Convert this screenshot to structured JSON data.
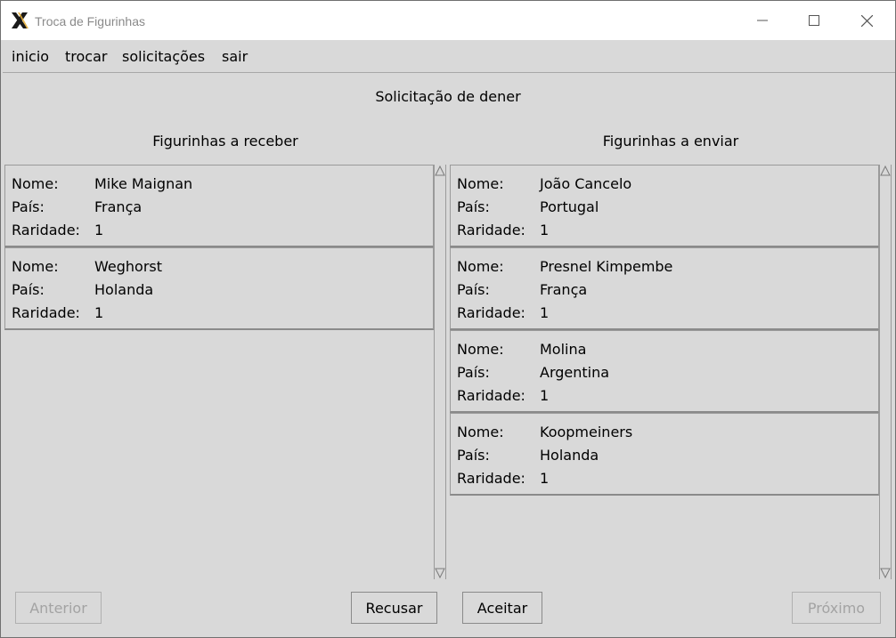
{
  "window": {
    "title": "Troca de Figurinhas",
    "controls": [
      "minimize-icon",
      "maximize-icon",
      "close-icon"
    ]
  },
  "menu": {
    "inicio": "inicio",
    "trocar": "trocar",
    "solicitacoes": "solicitações",
    "sair": "sair"
  },
  "page": {
    "title": "Solicitação de dener",
    "receive_heading": "Figurinhas a receber",
    "send_heading": "Figurinhas a enviar"
  },
  "labels": {
    "nome": "Nome:",
    "pais": "País:",
    "raridade": "Raridade:"
  },
  "receive": [
    {
      "nome": "Mike Maignan",
      "pais": "França",
      "raridade": "1"
    },
    {
      "nome": "Weghorst",
      "pais": "Holanda",
      "raridade": "1"
    }
  ],
  "send": [
    {
      "nome": "João Cancelo",
      "pais": "Portugal",
      "raridade": "1"
    },
    {
      "nome": "Presnel Kimpembe",
      "pais": "França",
      "raridade": "1"
    },
    {
      "nome": "Molina",
      "pais": "Argentina",
      "raridade": "1"
    },
    {
      "nome": "Koopmeiners",
      "pais": "Holanda",
      "raridade": "1"
    }
  ],
  "buttons": {
    "anterior": "Anterior",
    "recusar": "Recusar",
    "aceitar": "Aceitar",
    "proximo": "Próximo"
  },
  "colors": {
    "background": "#d9d9d9",
    "disabled_text": "#a3a3a3"
  }
}
